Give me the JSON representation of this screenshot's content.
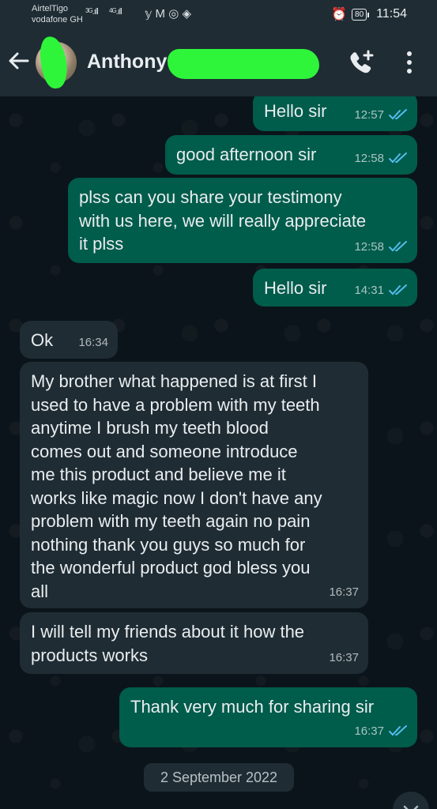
{
  "status_bar": {
    "carrier_1": "AirtelTigo",
    "carrier_2": "vodafone GH",
    "signal_1": "3G",
    "signal_2": "4G",
    "battery": "80",
    "time": "11:54"
  },
  "header": {
    "contact_name": "Anthony"
  },
  "messages": [
    {
      "direction": "out",
      "text": "Hello sir",
      "time": "12:57",
      "status": "read"
    },
    {
      "direction": "out",
      "text": "good afternoon sir",
      "time": "12:58",
      "status": "read"
    },
    {
      "direction": "out",
      "text": "plss can you share your testimony\nwith us here, we will really appreciate\nit plss",
      "time": "12:58",
      "status": "read"
    },
    {
      "direction": "out",
      "text": "Hello sir",
      "time": "14:31",
      "status": "read"
    },
    {
      "direction": "in",
      "text": "Ok",
      "time": "16:34"
    },
    {
      "direction": "in",
      "text": "My brother what happened is at first I\nused to have a problem with my teeth\nanytime I brush my teeth blood\ncomes out and someone introduce\nme this product and believe me it\nworks like magic now I don't have any\nproblem with my teeth again no pain\nnothing thank you guys so much for\nthe wonderful product god bless you\nall",
      "time": "16:37"
    },
    {
      "direction": "in",
      "text": "I will tell my friends about it how the\nproducts works",
      "time": "16:37"
    },
    {
      "direction": "out",
      "text": "Thank very much for sharing sir",
      "time": "16:37",
      "status": "read"
    }
  ],
  "date_separator": "2 September 2022",
  "colors": {
    "outgoing_bubble": "#005c4b",
    "incoming_bubble": "#1f2c34",
    "read_tick": "#53bdeb",
    "chat_background": "#0b141a"
  },
  "icons": {
    "back": "back-arrow-icon",
    "call": "add-call-icon",
    "menu": "more-vert-icon",
    "scroll": "chevron-down-icon"
  }
}
